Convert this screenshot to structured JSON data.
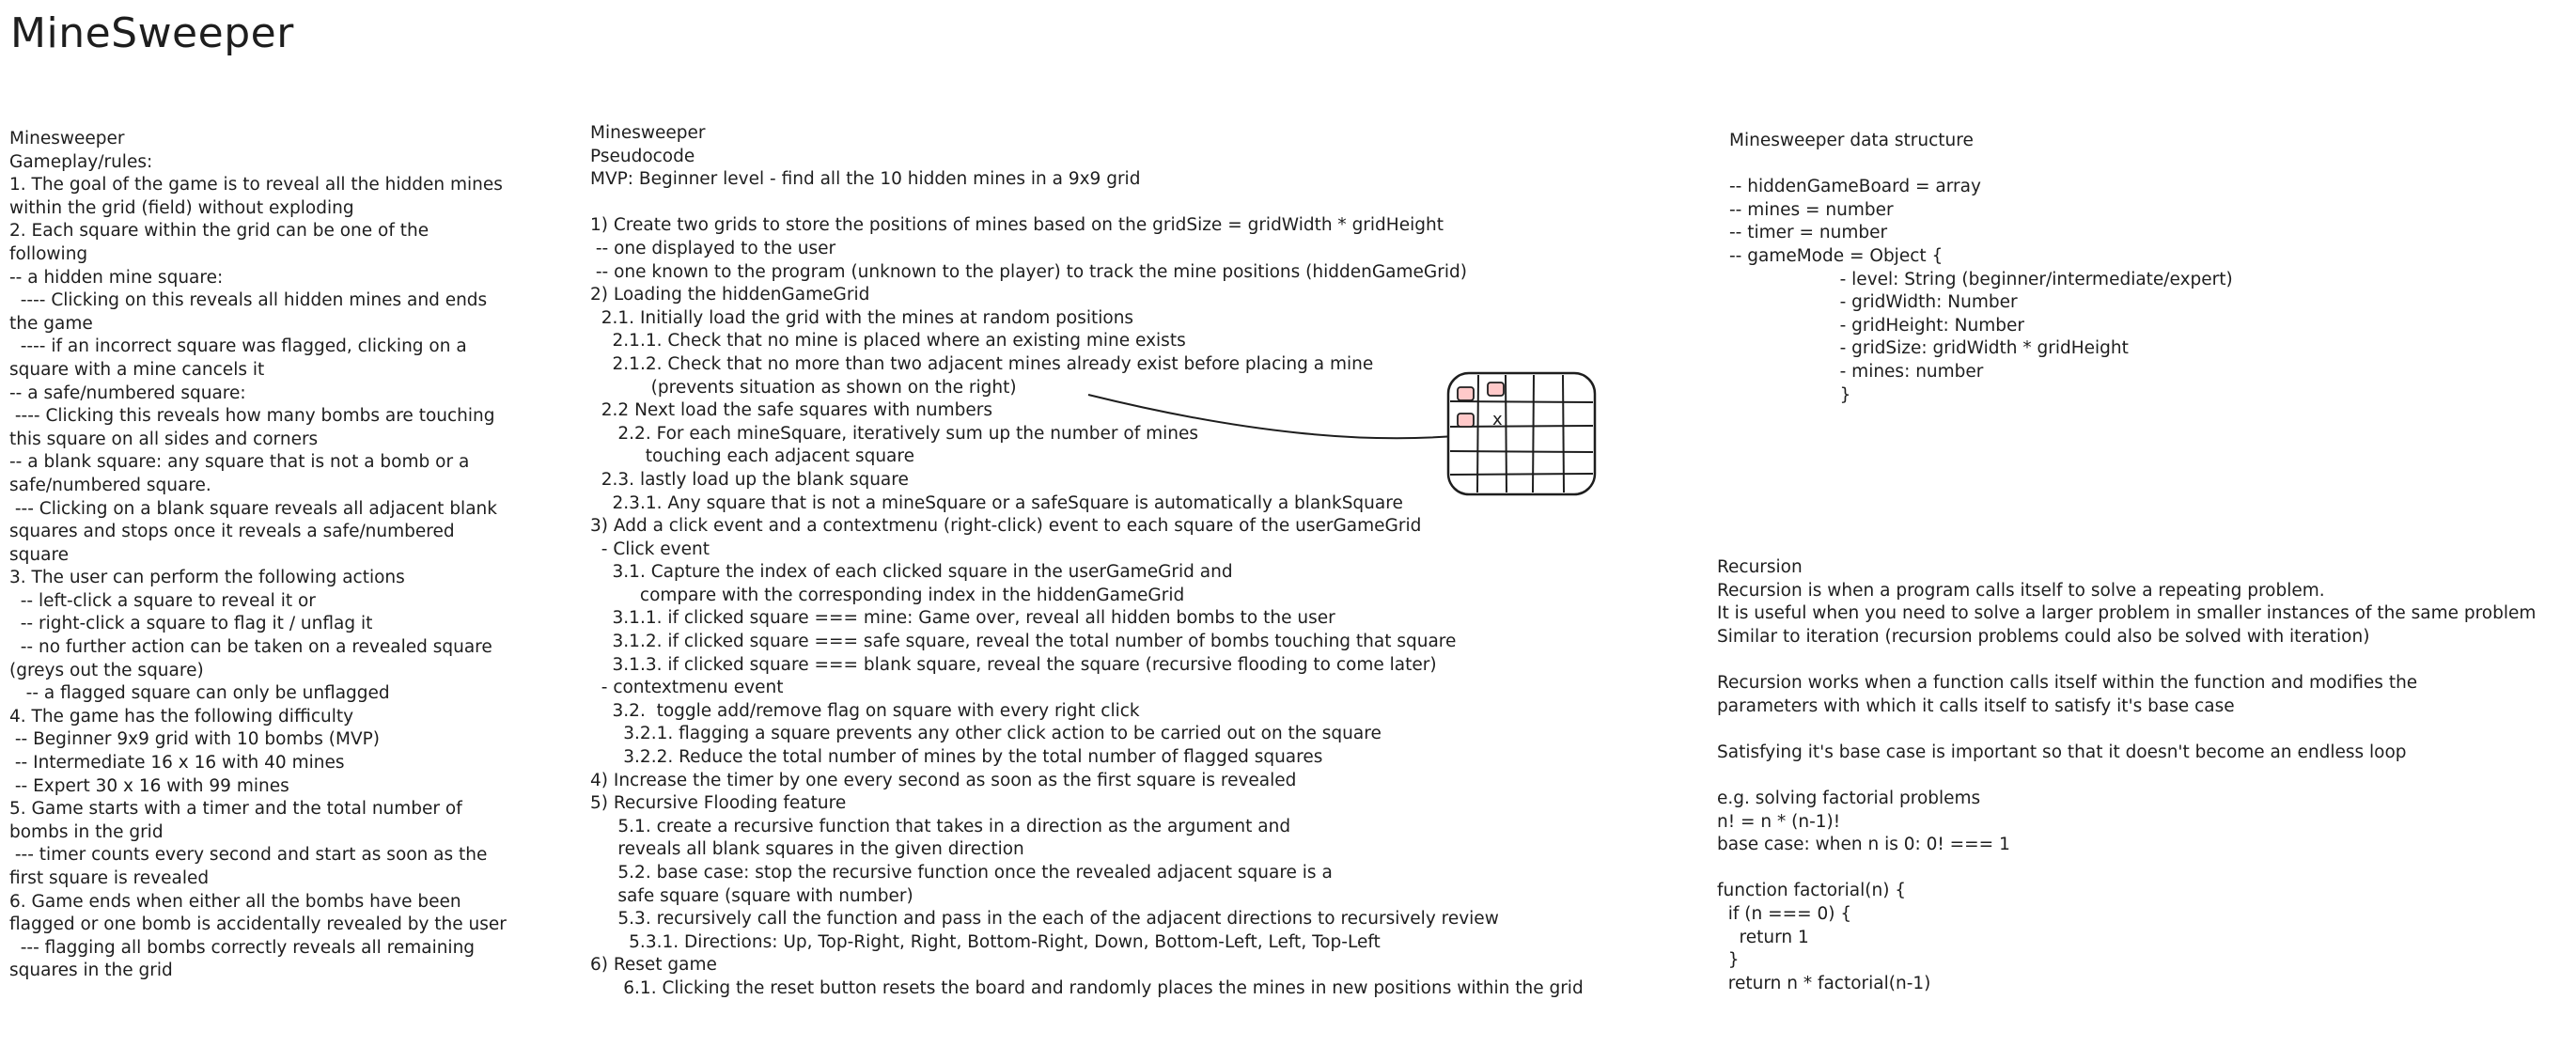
{
  "page_title": "MineSweeper",
  "rules": {
    "lines": [
      "Minesweeper",
      "Gameplay/rules:",
      "1. The goal of the game is to reveal all the hidden mines",
      "within the grid (field) without exploding",
      "2. Each square within the grid can be one of the",
      "following",
      "-- a hidden mine square:",
      "  ---- Clicking on this reveals all hidden mines and ends",
      "the game",
      "  ---- if an incorrect square was flagged, clicking on a",
      "square with a mine cancels it",
      "-- a safe/numbered square:",
      " ---- Clicking this reveals how many bombs are touching",
      "this square on all sides and corners",
      "-- a blank square: any square that is not a bomb or a",
      "safe/numbered square.",
      " --- Clicking on a blank square reveals all adjacent blank",
      "squares and stops once it reveals a safe/numbered",
      "square",
      "3. The user can perform the following actions",
      "  -- left-click a square to reveal it or",
      "  -- right-click a square to flag it / unflag it",
      "  -- no further action can be taken on a revealed square",
      "(greys out the square)",
      "   -- a flagged square can only be unflagged",
      "4. The game has the following difficulty",
      " -- Beginner 9x9 grid with 10 bombs (MVP)",
      " -- Intermediate 16 x 16 with 40 mines",
      " -- Expert 30 x 16 with 99 mines",
      "5. Game starts with a timer and the total number of",
      "bombs in the grid",
      " --- timer counts every second and start as soon as the",
      "first square is revealed",
      "6. Game ends when either all the bombs have been",
      "flagged or one bomb is accidentally revealed by the user",
      "  --- flagging all bombs correctly reveals all remaining",
      "squares in the grid"
    ]
  },
  "pseudocode": {
    "lines": [
      "Minesweeper",
      "Pseudocode",
      "MVP: Beginner level - find all the 10 hidden mines in a 9x9 grid",
      "",
      "1) Create two grids to store the positions of mines based on the gridSize = gridWidth * gridHeight",
      " -- one displayed to the user",
      " -- one known to the program (unknown to the player) to track the mine positions (hiddenGameGrid)",
      "2) Loading the hiddenGameGrid",
      "  2.1. Initially load the grid with the mines at random positions",
      "    2.1.1. Check that no mine is placed where an existing mine exists",
      "    2.1.2. Check that no more than two adjacent mines already exist before placing a mine",
      "           (prevents situation as shown on the right)",
      "  2.2 Next load the safe squares with numbers",
      "     2.2. For each mineSquare, iteratively sum up the number of mines",
      "          touching each adjacent square",
      "  2.3. lastly load up the blank square",
      "    2.3.1. Any square that is not a mineSquare or a safeSquare is automatically a blankSquare",
      "3) Add a click event and a contextmenu (right-click) event to each square of the userGameGrid",
      "  - Click event",
      "    3.1. Capture the index of each clicked square in the userGameGrid and",
      "         compare with the corresponding index in the hiddenGameGrid",
      "    3.1.1. if clicked square === mine: Game over, reveal all hidden bombs to the user",
      "    3.1.2. if clicked square === safe square, reveal the total number of bombs touching that square",
      "    3.1.3. if clicked square === blank square, reveal the square (recursive flooding to come later)",
      "  - contextmenu event",
      "    3.2.  toggle add/remove flag on square with every right click",
      "      3.2.1. flagging a square prevents any other click action to be carried out on the square",
      "      3.2.2. Reduce the total number of mines by the total number of flagged squares",
      "4) Increase the timer by one every second as soon as the first square is revealed",
      "5) Recursive Flooding feature",
      "     5.1. create a recursive function that takes in a direction as the argument and",
      "     reveals all blank squares in the given direction",
      "     5.2. base case: stop the recursive function once the revealed adjacent square is a",
      "     safe square (square with number)",
      "     5.3. recursively call the function and pass in the each of the adjacent directions to recursively review",
      "       5.3.1. Directions: Up, Top-Right, Right, Bottom-Right, Down, Bottom-Left, Left, Top-Left",
      "6) Reset game",
      "      6.1. Clicking the reset button resets the board and randomly places the mines in new positions within the grid"
    ]
  },
  "data_structure": {
    "lines": [
      "Minesweeper data structure",
      "",
      "-- hiddenGameBoard = array",
      "-- mines = number",
      "-- timer = number",
      "-- gameMode = Object {",
      "                    - level: String (beginner/intermediate/expert)",
      "                    - gridWidth: Number",
      "                    - gridHeight: Number",
      "                    - gridSize: gridWidth * gridHeight",
      "                    - mines: number",
      "                    }"
    ]
  },
  "recursion": {
    "lines": [
      "Recursion",
      "Recursion is when a program calls itself to solve a repeating problem.",
      "It is useful when you need to solve a larger problem in smaller instances of the same problem",
      "Similar to iteration (recursion problems could also be solved with iteration)",
      "",
      "Recursion works when a function calls itself within the function and modifies the",
      "parameters with which it calls itself to satisfy it's base case",
      "",
      "Satisfying it's base case is important so that it doesn't become an endless loop",
      "",
      "e.g. solving factorial problems",
      "n! = n * (n-1)!",
      "base case: when n is 0: 0! === 1",
      "",
      "function factorial(n) {",
      "  if (n === 0) {",
      "    return 1",
      "  }",
      "  return n * factorial(n-1)"
    ]
  },
  "sketch": {
    "cross_mark": "x",
    "mine_fill": "#ffc9c9",
    "stroke": "#1e1e1e"
  }
}
